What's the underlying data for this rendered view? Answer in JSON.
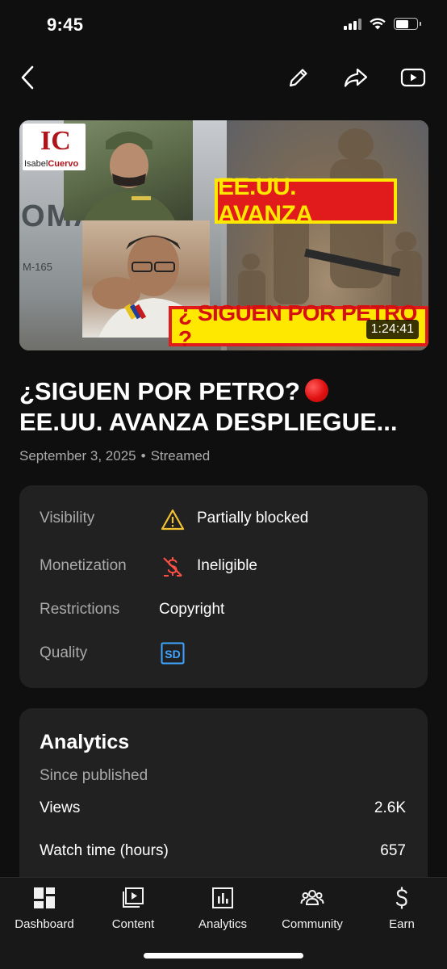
{
  "status_bar": {
    "time": "9:45"
  },
  "top_nav": {
    "back_icon": "chevron-left-icon",
    "edit_icon": "pencil-icon",
    "share_icon": "share-arrow-icon",
    "watch_icon": "youtube-play-icon"
  },
  "thumbnail": {
    "logo_mark": "IC",
    "logo_name_plain": "Isabel",
    "logo_name_bold": "Cuervo",
    "banner_top": "EE.UU. AVANZA",
    "banner_bottom": "¿ SIGUEN POR PETRO ?",
    "aircraft_text": "OMA",
    "aircraft_code": "M-165",
    "duration": "1:24:41"
  },
  "video": {
    "title_line1": "¿SIGUEN POR PETRO?",
    "title_line2": "EE.UU. AVANZA DESPLIEGUE...",
    "date": "September 3, 2025",
    "separator": "•",
    "status": "Streamed"
  },
  "details": {
    "visibility_label": "Visibility",
    "visibility_value": "Partially blocked",
    "monetization_label": "Monetization",
    "monetization_value": "Ineligible",
    "restrictions_label": "Restrictions",
    "restrictions_value": "Copyright",
    "quality_label": "Quality",
    "quality_badge": "SD",
    "colors": {
      "warning": "#f2c230",
      "monetization": "#ff4e45",
      "sd_badge": "#3ea6ff"
    }
  },
  "analytics": {
    "title": "Analytics",
    "subtitle": "Since published",
    "rows": [
      {
        "label": "Views",
        "value": "2.6K"
      },
      {
        "label": "Watch time (hours)",
        "value": "657"
      }
    ]
  },
  "bottom_nav": {
    "items": [
      {
        "label": "Dashboard",
        "icon": "dashboard-icon"
      },
      {
        "label": "Content",
        "icon": "content-icon"
      },
      {
        "label": "Analytics",
        "icon": "analytics-icon"
      },
      {
        "label": "Community",
        "icon": "community-icon"
      },
      {
        "label": "Earn",
        "icon": "earn-icon"
      }
    ]
  }
}
